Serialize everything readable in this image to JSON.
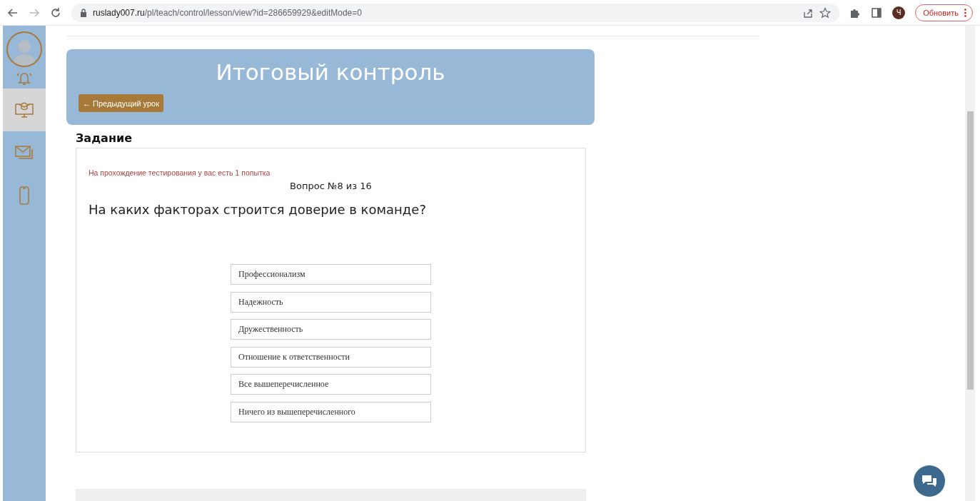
{
  "browser": {
    "url_host": "ruslady007.ru",
    "url_path": "/pl/teach/control/lesson/view?id=286659929&editMode=0",
    "profile_initial": "Ч",
    "update_button": "Обновить"
  },
  "sidebar": {
    "items": [
      {
        "kind": "bell",
        "selected": false
      },
      {
        "kind": "course",
        "selected": true
      },
      {
        "kind": "mail",
        "selected": false
      },
      {
        "kind": "phone",
        "selected": false
      }
    ]
  },
  "lesson": {
    "title": "Итоговый контроль",
    "prev_button": "← Предыдущий урок"
  },
  "task": {
    "heading": "Задание",
    "attempts_note": "На прохождение тестирования у вас есть 1 попытка",
    "counter": "Вопрос №8 из 16",
    "question": "На каких факторах строится доверие в команде?",
    "options": [
      {
        "label": "Профессионализм"
      },
      {
        "label": "Надежность"
      },
      {
        "label": "Дружественность"
      },
      {
        "label": "Отношение к ответственности"
      },
      {
        "label": "Все вышеперечисленное"
      },
      {
        "label": "Ничего из вышеперечисленного"
      }
    ]
  }
}
